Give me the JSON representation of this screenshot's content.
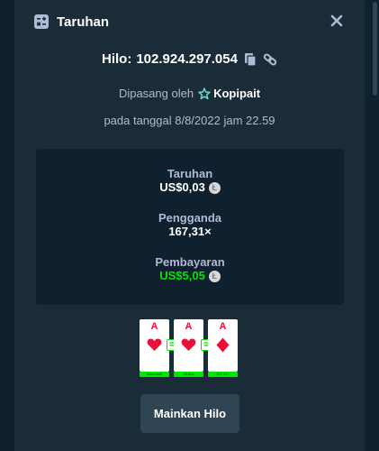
{
  "header": {
    "title": "Taruhan",
    "icon": "bets-icon",
    "close_icon": "close-icon"
  },
  "bet": {
    "game_label": "Hilo:",
    "bet_id": "102.924.297.054",
    "placed_by_prefix": "Dipasang oleh",
    "username": "Kopipait",
    "date_text": "pada tanggal 8/8/2022 jam 22.59"
  },
  "stats": {
    "wager_label": "Taruhan",
    "wager_value": "US$0,03",
    "multiplier_label": "Pengganda",
    "multiplier_value": "167,31×",
    "payout_label": "Pembayaran",
    "payout_value": "US$5,05",
    "currency_icon": "litecoin-icon"
  },
  "cards": [
    {
      "rank": "A",
      "suit": "hearts",
      "badge": "Start card"
    },
    {
      "rank": "A",
      "suit": "hearts",
      "badge": "13,82×"
    },
    {
      "rank": "A",
      "suit": "diamonds",
      "badge": "167,31×"
    }
  ],
  "play_button_label": "Mainkan Hilo",
  "colors": {
    "background": "#1a2c38",
    "panel": "#0f212e",
    "accent_green": "#00e701",
    "card_red": "#e9113c",
    "button": "#2f4553"
  }
}
